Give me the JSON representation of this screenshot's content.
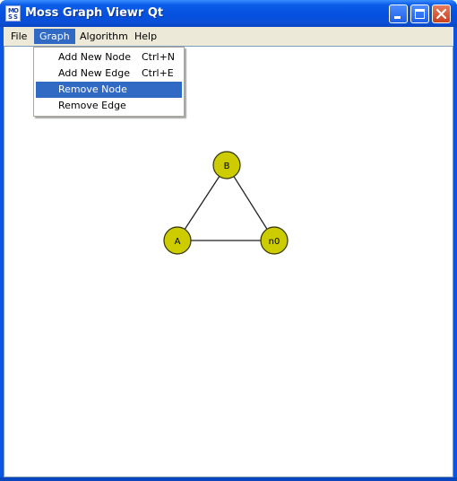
{
  "window": {
    "title": "Moss Graph Viewr Qt",
    "icon_letters": [
      "M",
      "O",
      "S",
      "S"
    ]
  },
  "menubar": {
    "items": [
      {
        "label": "File"
      },
      {
        "label": "Graph",
        "active": true
      },
      {
        "label": "Algorithm"
      },
      {
        "label": "Help"
      }
    ]
  },
  "graph_menu": {
    "items": [
      {
        "label": "Add New Node",
        "shortcut": "Ctrl+N"
      },
      {
        "label": "Add New Edge",
        "shortcut": "Ctrl+E"
      },
      {
        "label": "Remove Node",
        "shortcut": "",
        "highlighted": true
      },
      {
        "label": "Remove Edge",
        "shortcut": ""
      }
    ]
  },
  "graph": {
    "nodes": [
      {
        "id": "B",
        "label": "B"
      },
      {
        "id": "A",
        "label": "A"
      },
      {
        "id": "n0",
        "label": "n0"
      }
    ],
    "edges": [
      [
        "B",
        "A"
      ],
      [
        "B",
        "n0"
      ],
      [
        "A",
        "n0"
      ]
    ],
    "colors": {
      "node_fill": "#cccc00",
      "node_stroke": "#333300",
      "edge": "#222222"
    }
  },
  "colors": {
    "titlebar": "#0550e0",
    "menu_highlight": "#316ac5",
    "client_bg": "#ece9d8",
    "close_button": "#d2512f"
  }
}
